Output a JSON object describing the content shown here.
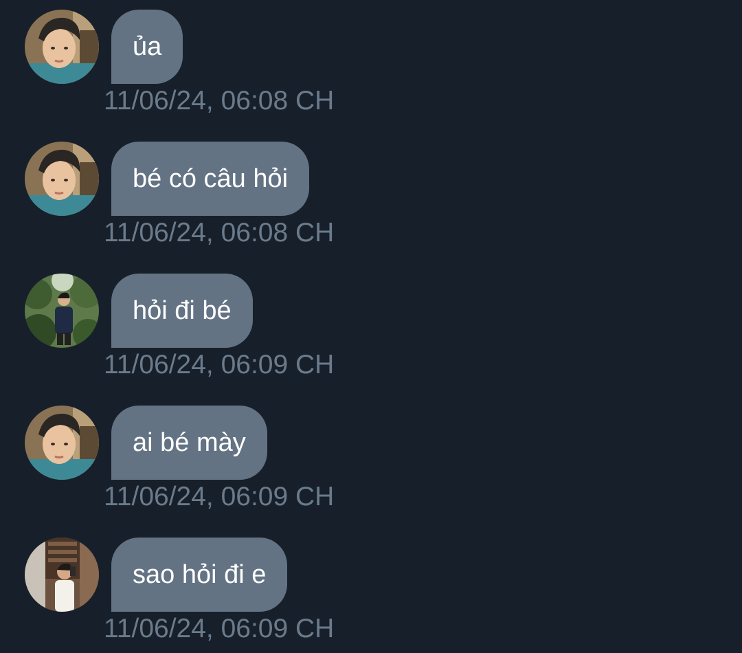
{
  "colors": {
    "background": "#17202a",
    "bubble": "#637384",
    "bubble_text": "#ffffff",
    "timestamp": "#6b7b8c"
  },
  "messages": [
    {
      "sender_avatar": "avatar-a",
      "text": "ủa",
      "time": "11/06/24, 06:08 CH"
    },
    {
      "sender_avatar": "avatar-a",
      "text": "bé có câu hỏi",
      "time": "11/06/24, 06:08 CH"
    },
    {
      "sender_avatar": "avatar-b",
      "text": "hỏi đi bé",
      "time": "11/06/24, 06:09 CH"
    },
    {
      "sender_avatar": "avatar-a",
      "text": "ai bé mày",
      "time": "11/06/24, 06:09 CH"
    },
    {
      "sender_avatar": "avatar-c",
      "text": "sao hỏi đi e",
      "time": "11/06/24, 06:09 CH"
    }
  ]
}
